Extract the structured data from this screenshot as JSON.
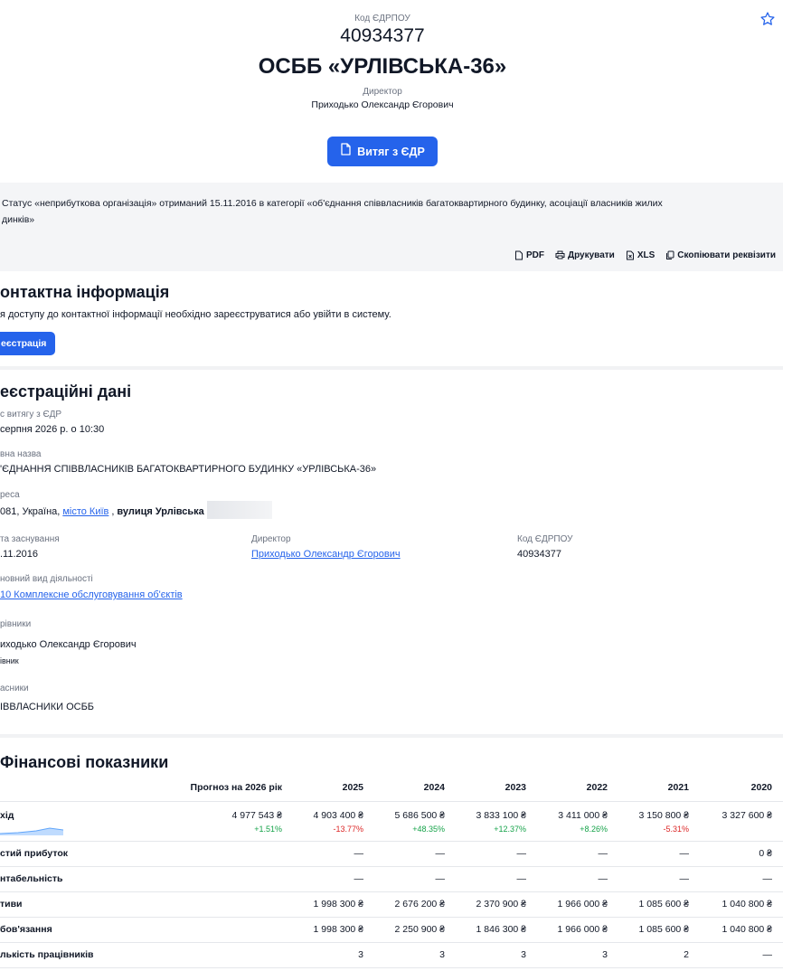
{
  "header": {
    "code_label": "Код ЄДРПОУ",
    "code": "40934377",
    "name": "ОСББ «УРЛІВСЬКА-36»",
    "director_label": "Директор",
    "director": "Приходько Олександр Єгорович",
    "extract_button": "Витяг з ЄДР"
  },
  "status_note": {
    "line1": "Статус «неприбуткова організація» отриманий 15.11.2016 в категорії «об'єднання співвласників багатоквартирного будинку, асоціації власників жилих",
    "line2": "динків»"
  },
  "toolbar": {
    "pdf": "PDF",
    "print": "Друкувати",
    "xls": "XLS",
    "copy": "Скопіювати реквізити"
  },
  "contacts": {
    "title": "онтактна інформація",
    "text": "я доступу до контактної інформації необхідно зареєструватися або увійти в систему.",
    "register_button": "еєстрація"
  },
  "registration": {
    "title": "еєстраційні дані",
    "extract_time_label": "с витягу з ЄДР",
    "extract_time": "серпня 2026 р. о 10:30",
    "full_name_label": "вна назва",
    "full_name": "'ЄДНАННЯ СПІВВЛАСНИКІВ БАГАТОКВАРТИРНОГО БУДИНКУ «УРЛІВСЬКА-36»",
    "address_label": "реса",
    "address_prefix": "081, Україна,",
    "address_city": "місто Київ",
    "address_street": "вулиця Урлівська",
    "founded_label": "та заснування",
    "founded": ".11.2016",
    "director_label": "Директор",
    "director": "Приходько Олександр Єгорович",
    "code_label": "Код ЄДРПОУ",
    "code": "40934377",
    "activity_label": "новний вид діяльності",
    "activity": "10 Комплексне обслуговування об'єктів",
    "heads_label": "рівники",
    "head_name": "иходько Олександр Єгорович",
    "head_role": "івник",
    "owners_label": "асники",
    "owners": "ІВВЛАСНИКИ ОСББ"
  },
  "finance": {
    "title": "Фінансові показники",
    "columns": [
      "Прогноз на 2026 рік",
      "2025",
      "2024",
      "2023",
      "2022",
      "2021",
      "2020"
    ],
    "income_label": "хід",
    "income_values": [
      "4 977 543 ₴",
      "4 903 400 ₴",
      "5 686 500 ₴",
      "3 833 100 ₴",
      "3 411 000 ₴",
      "3 150 800 ₴",
      "3 327 600 ₴"
    ],
    "income_changes": [
      "+1.51%",
      "-13.77%",
      "+48.35%",
      "+12.37%",
      "+8.26%",
      "-5.31%",
      ""
    ],
    "rows": [
      {
        "label": "стий прибуток",
        "values": [
          "",
          "—",
          "—",
          "—",
          "—",
          "—",
          "0 ₴"
        ]
      },
      {
        "label": "нтабельність",
        "values": [
          "",
          "—",
          "—",
          "—",
          "—",
          "—",
          "—"
        ]
      },
      {
        "label": "тиви",
        "values": [
          "",
          "1 998 300 ₴",
          "2 676 200 ₴",
          "2 370 900 ₴",
          "1 966 000 ₴",
          "1 085 600 ₴",
          "1 040 800 ₴"
        ]
      },
      {
        "label": "бов'язання",
        "values": [
          "",
          "1 998 300 ₴",
          "2 250 900 ₴",
          "1 846 300 ₴",
          "1 966 000 ₴",
          "1 085 600 ₴",
          "1 040 800 ₴"
        ]
      },
      {
        "label": "лькість працівників",
        "values": [
          "",
          "3",
          "3",
          "3",
          "3",
          "2",
          "—"
        ]
      }
    ]
  },
  "colors": {
    "accent": "#2563eb",
    "panel": "#f4f5f7",
    "positive": "#16a34a",
    "negative": "#dc2626"
  }
}
